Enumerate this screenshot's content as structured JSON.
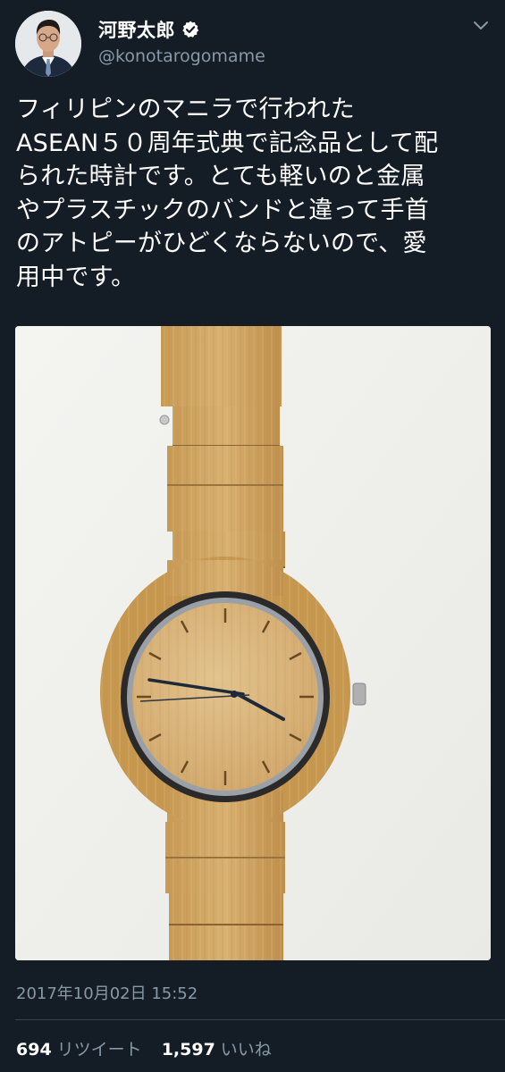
{
  "colors": {
    "background": "#141d26",
    "text_primary": "#ffffff",
    "text_secondary": "#8899a6",
    "divider": "#38444d"
  },
  "author": {
    "display_name": "河野太郎",
    "handle": "@konotarogomame",
    "verified": true,
    "avatar_icon": "avatar-photo",
    "verified_icon": "verified-badge-icon"
  },
  "menu": {
    "icon": "chevron-down-icon"
  },
  "tweet": {
    "text": "フィリピンのマニラで行われた\nASEAN５０周年式典で記念品として配\nられた時計です。とても軽いのと金属\nやプラスチックのバンドと違って手首\nのアトピーがひどくならないので、愛\n用中です。",
    "photo_subject": "bamboo wooden wristwatch",
    "timestamp": "2017年10月02日 15:52"
  },
  "stats": {
    "retweets_count": "694",
    "retweets_label": "リツイート",
    "likes_count": "1,597",
    "likes_label": "いいね"
  }
}
